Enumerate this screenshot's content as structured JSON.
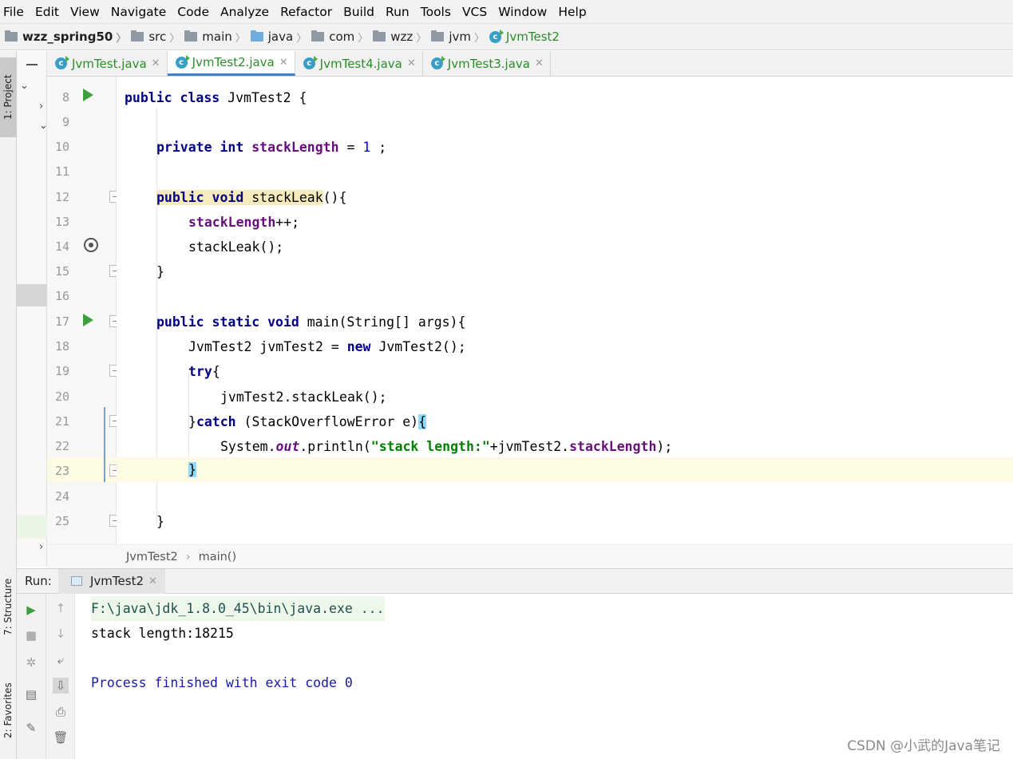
{
  "menu": [
    "File",
    "Edit",
    "View",
    "Navigate",
    "Code",
    "Analyze",
    "Refactor",
    "Build",
    "Run",
    "Tools",
    "VCS",
    "Window",
    "Help"
  ],
  "breadcrumb": {
    "project": "wzz_spring50",
    "parts": [
      "src",
      "main",
      "java",
      "com",
      "wzz",
      "jvm"
    ],
    "file": "JvmTest2"
  },
  "tabs": [
    {
      "label": "JvmTest.java",
      "active": false
    },
    {
      "label": "JvmTest2.java",
      "active": true
    },
    {
      "label": "JvmTest4.java",
      "active": false
    },
    {
      "label": "JvmTest3.java",
      "active": false
    }
  ],
  "tool_windows": {
    "project": "1: Project",
    "structure": "7: Structure",
    "favorites": "2: Favorites"
  },
  "line_numbers": [
    "8",
    "9",
    "10",
    "11",
    "12",
    "13",
    "14",
    "15",
    "16",
    "17",
    "18",
    "19",
    "20",
    "21",
    "22",
    "23",
    "24",
    "25"
  ],
  "code": {
    "l8_kw": "public class ",
    "l8_rest": "JvmTest2 {",
    "l10_kw1": "private ",
    "l10_kw2": "int ",
    "l10_field": "stackLength",
    "l10_op": " = ",
    "l10_num": "1",
    "l10_end": " ;",
    "l12_kw": "public void ",
    "l12_name": "stackLeak",
    "l12_rest": "(){",
    "l13_field": "stackLength",
    "l13_rest": "++;",
    "l14": "stackLeak();",
    "l15": "}",
    "l17_kw": "public static void ",
    "l17_rest": "main(String[] args){",
    "l18_a": "JvmTest2 jvmTest2 = ",
    "l18_kw": "new ",
    "l18_b": "JvmTest2();",
    "l19_kw": "try",
    "l19_rest": "{",
    "l20": "jvmTest2.stackLeak();",
    "l21_a": "}",
    "l21_kw": "catch ",
    "l21_b": "(StackOverflowError e)",
    "l21_brace": "{",
    "l22_a": "System.",
    "l22_static": "out",
    "l22_b": ".println(",
    "l22_str": "\"stack length:\"",
    "l22_c": "+jvmTest2.",
    "l22_field": "stackLength",
    "l22_d": ");",
    "l23_brace": "}",
    "l25": "}"
  },
  "code_breadcrumb": {
    "cls": "JvmTest2",
    "method": "main()"
  },
  "run": {
    "label": "Run:",
    "tab": "JvmTest2",
    "output": [
      "F:\\java\\jdk_1.8.0_45\\bin\\java.exe ...",
      "stack length:18215",
      "",
      "Process finished with exit code 0"
    ]
  },
  "watermark": "CSDN @小武的Java笔记",
  "colors": {
    "keyword": "#000080",
    "field": "#660e7a",
    "string": "#008000",
    "number": "#0000ff",
    "run_green": "#3d9f3d"
  }
}
